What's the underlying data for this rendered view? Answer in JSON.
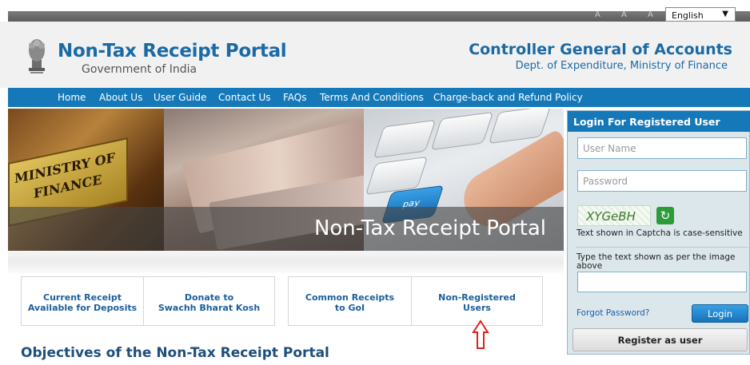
{
  "top_bar": {
    "font_controls": [
      "A",
      "A",
      "A"
    ],
    "language": "English",
    "language_caret": "▼"
  },
  "header": {
    "portal_title": "Non-Tax Receipt Portal",
    "portal_subtitle": "Government of India",
    "org_title": "Controller General of Accounts",
    "org_subtitle": "Dept. of Expenditure, Ministry of Finance"
  },
  "nav": {
    "items": [
      "Home",
      "About Us",
      "User Guide",
      "Contact Us",
      "FAQs",
      "Terms And Conditions",
      "Charge-back and Refund Policy"
    ]
  },
  "banner": {
    "caption": "Non-Tax Receipt Portal",
    "sign_text": [
      "MINISTRY OF",
      "FINANCE"
    ],
    "key_label": "pay"
  },
  "links": {
    "group1": [
      {
        "line1": "Current Receipt",
        "line2": "Available for Deposits"
      },
      {
        "line1": "Donate to",
        "line2": "Swachh Bharat Kosh"
      }
    ],
    "group2": [
      {
        "line1": "Common Receipts",
        "line2": "to GoI"
      },
      {
        "line1": "Non-Registered",
        "line2": "Users"
      }
    ]
  },
  "objectives_heading": "Objectives of the Non-Tax Receipt Portal",
  "login": {
    "heading": "Login For Registered User",
    "username_placeholder": "User Name",
    "password_placeholder": "Password",
    "captcha_text": "XYGeBH",
    "captcha_note": "Text shown in Captcha is case-sensitive",
    "captcha_prompt": "Type the text shown as per the image above",
    "forgot_password": "Forgot Password?",
    "login_button": "Login",
    "register_button": "Register as user"
  },
  "colors": {
    "brand_blue": "#1b6aa5",
    "nav_blue": "#1579b9",
    "annotation_red": "#e02020"
  }
}
